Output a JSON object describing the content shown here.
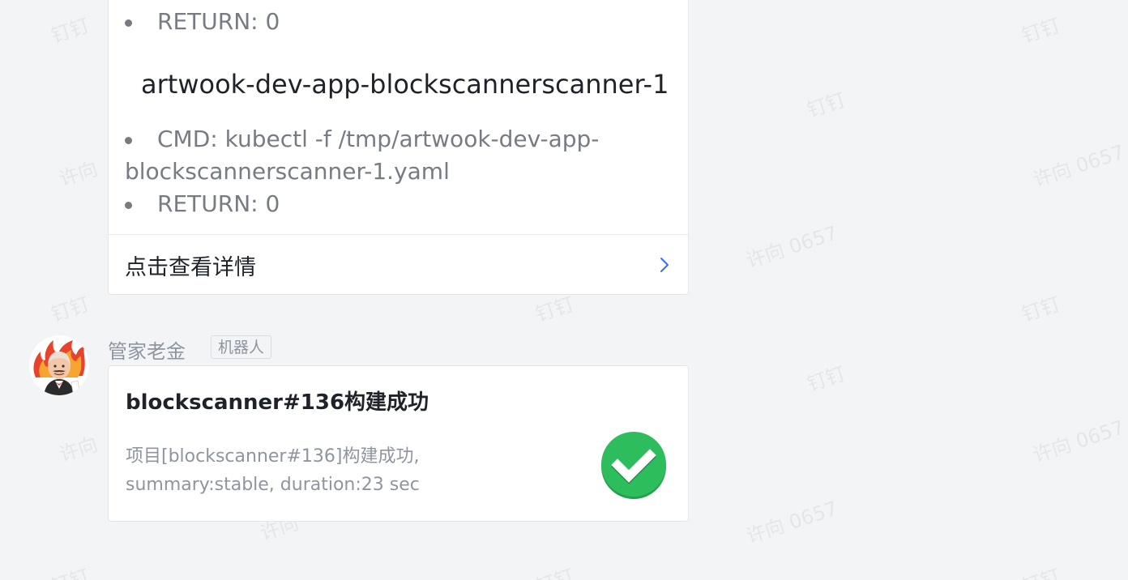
{
  "watermark": {
    "text_a": "钉钉",
    "text_b": "许向 0657",
    "text_c": "许向"
  },
  "top_card": {
    "first_bullets": [
      {
        "text": "RETURN: 0"
      }
    ],
    "section_heading": "artwook-dev-app-blockscannerscanner-1",
    "second_bullets": [
      {
        "text": "CMD: kubectl -f /tmp/artwook-dev-app-blockscannerscanner-1.yaml"
      },
      {
        "text": "RETURN: 0"
      }
    ],
    "details_label": "点击查看详情",
    "chevron": "chevron-right-icon"
  },
  "message": {
    "sender": "管家老金",
    "badge": "机器人",
    "avatar": "jenkins-avatar-icon"
  },
  "build_card": {
    "title": "blockscanner#136构建成功",
    "desc_line1": "项目[blockscanner#136]构建成功,",
    "desc_line2": "summary:stable, duration:23 sec",
    "status_icon": "check-success-icon",
    "status_color": "#2ebd5c"
  },
  "colors": {
    "background": "#f3f4f6",
    "card": "#ffffff",
    "text_primary": "#1f2329",
    "text_secondary": "#8f959e",
    "link_chevron": "#3370ff"
  }
}
